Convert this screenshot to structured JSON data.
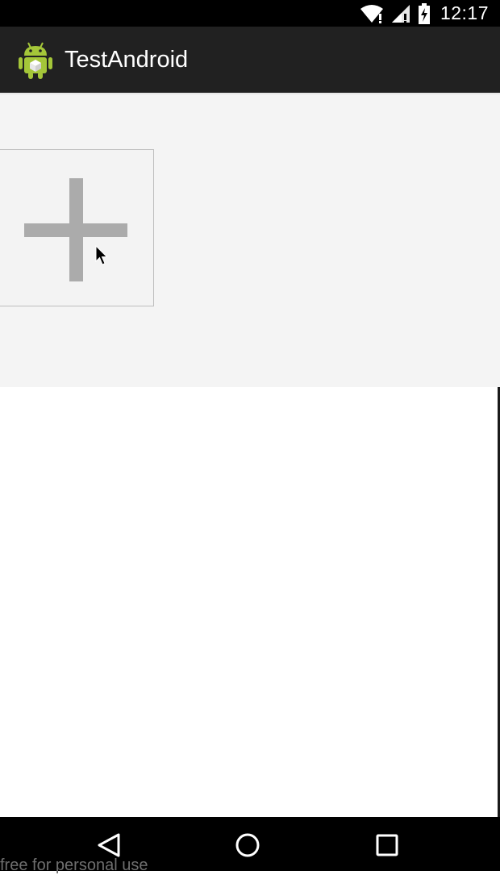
{
  "status_bar": {
    "time": "12:17",
    "icons": [
      "wifi-icon",
      "signal-icon",
      "battery-charging-icon"
    ]
  },
  "action_bar": {
    "title": "TestAndroid",
    "icon": "android-robot-icon"
  },
  "content": {
    "add_button_icon": "plus-icon"
  },
  "nav_bar": {
    "icons": [
      "back-icon",
      "home-icon",
      "recents-icon"
    ]
  },
  "watermark": {
    "text": "free for personal use"
  },
  "colors": {
    "status_bar": "#000000",
    "action_bar": "#212121",
    "content_background": "#f4f4f4",
    "plus_gray": "#ababab",
    "android_green": "#a4c639"
  }
}
